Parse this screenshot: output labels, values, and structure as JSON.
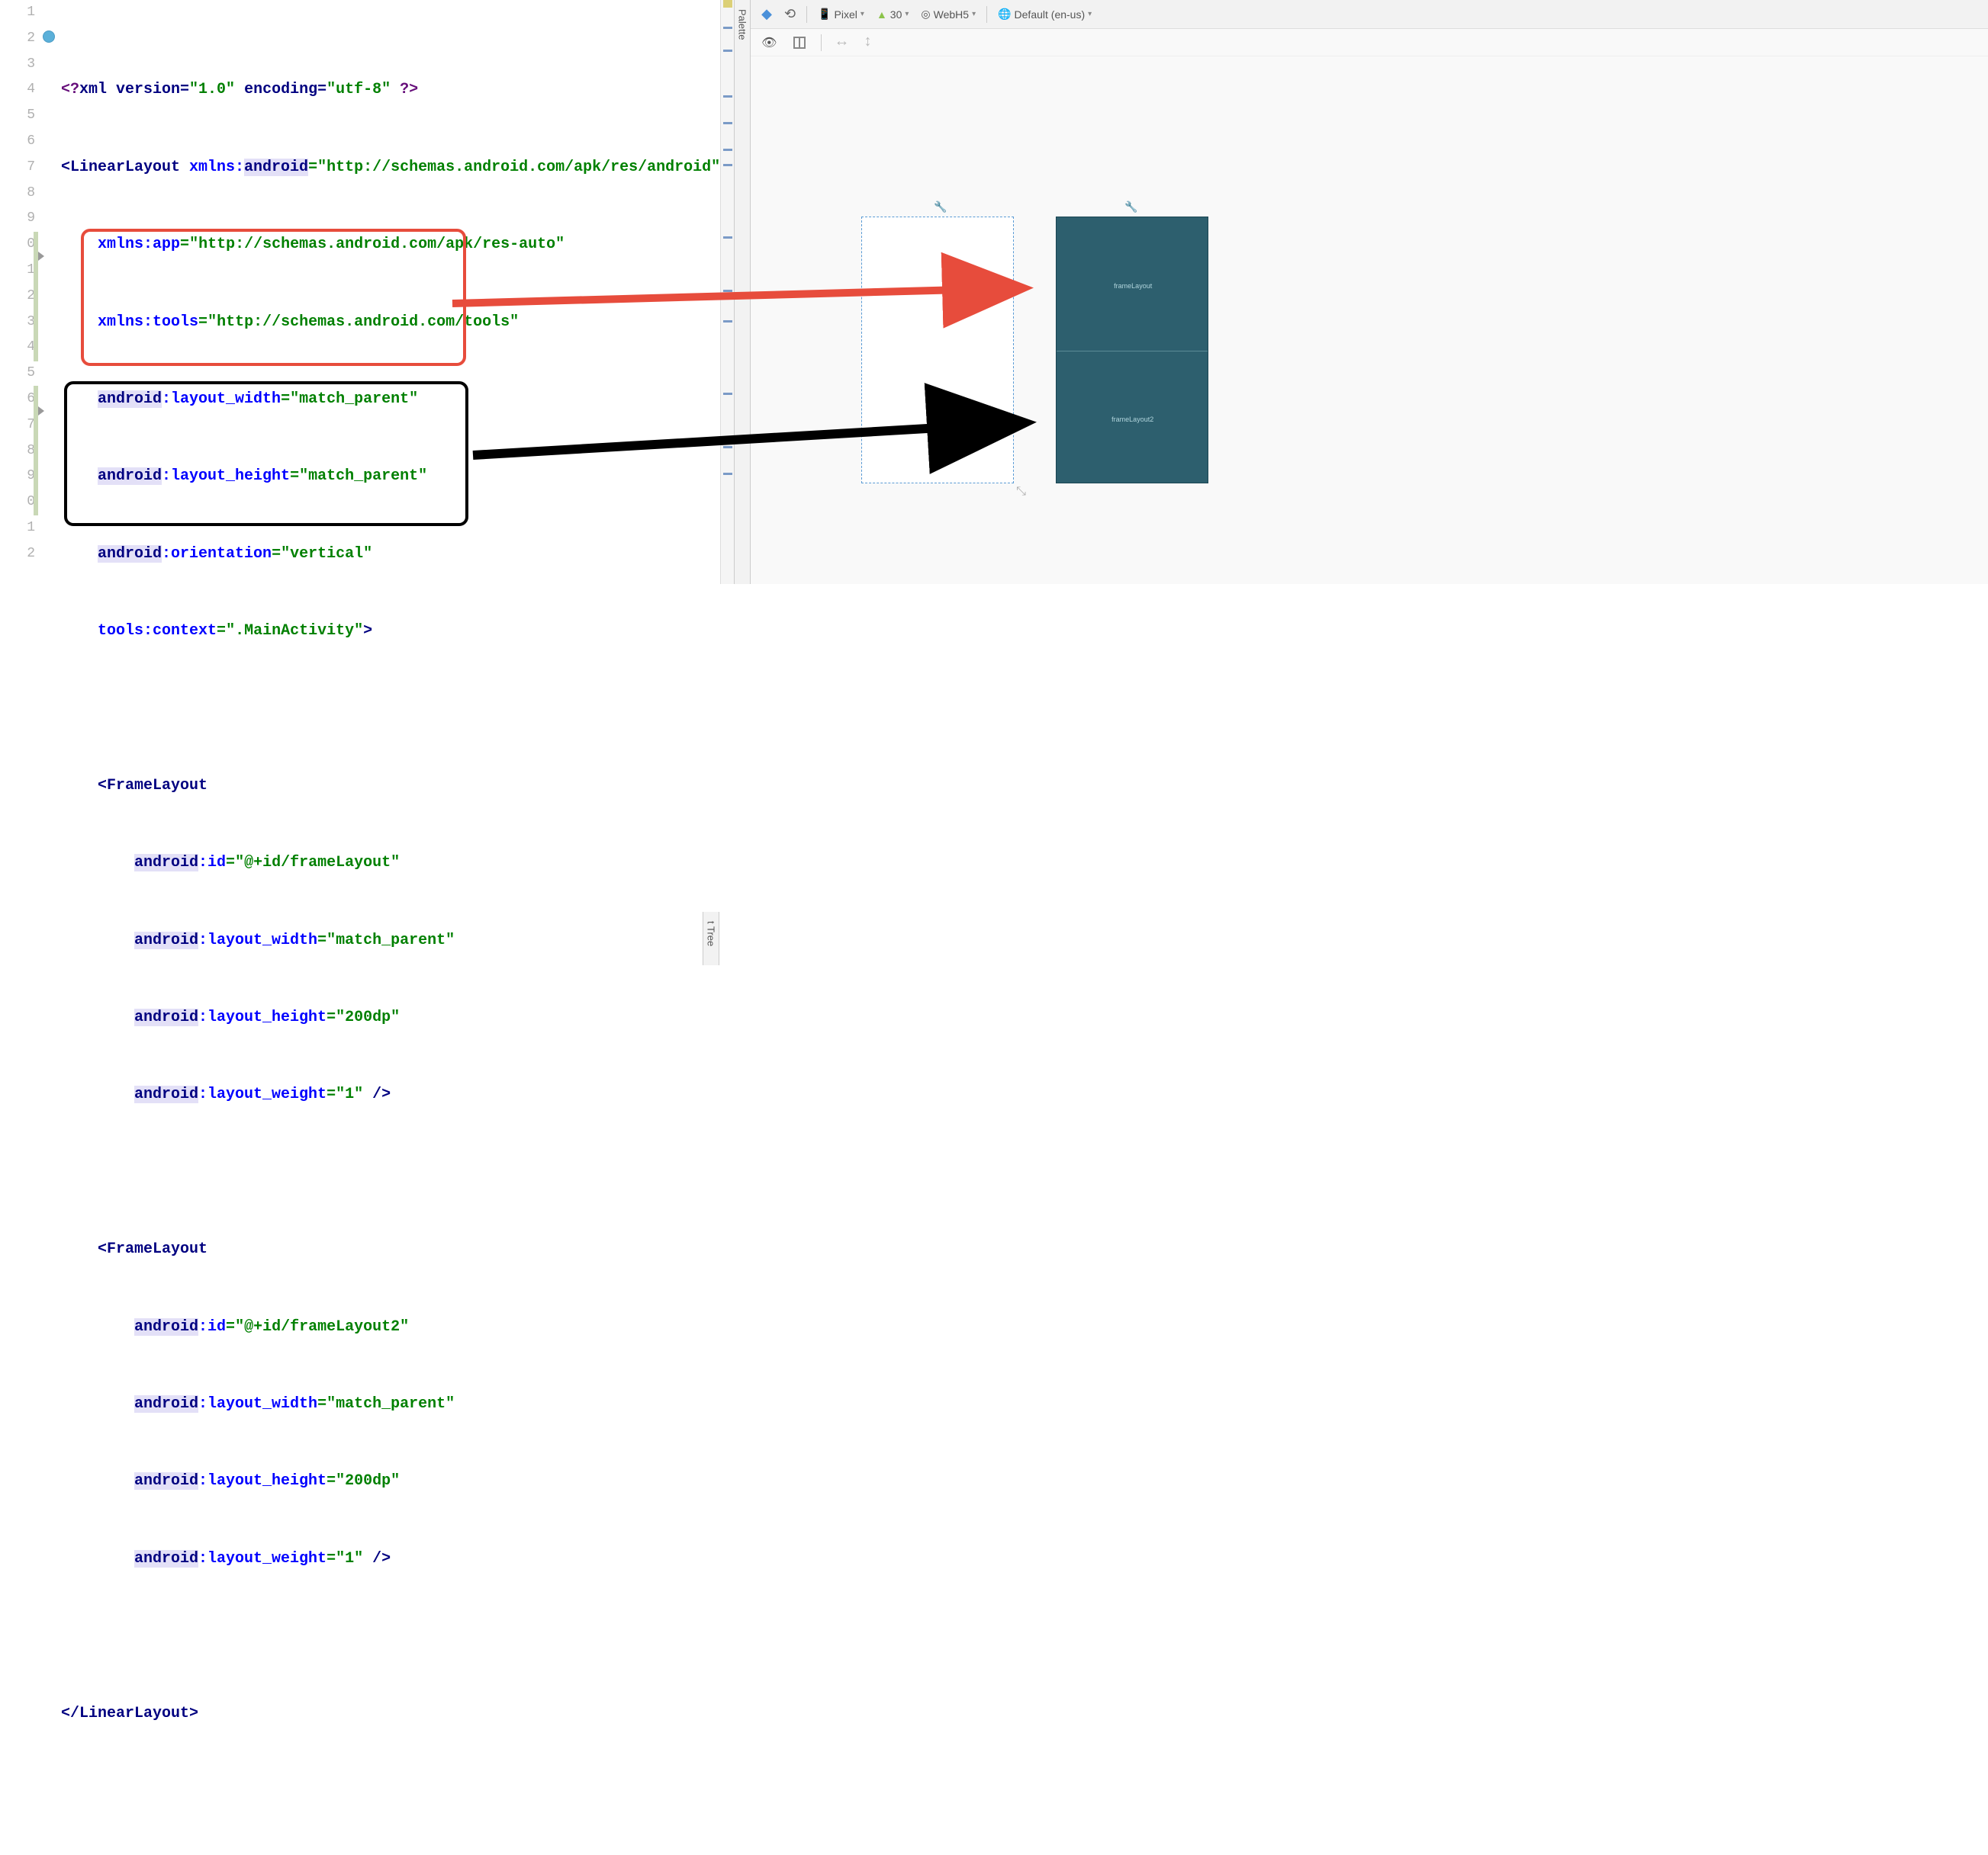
{
  "toolbar": {
    "device": "Pixel",
    "api": "30",
    "theme": "WebH5",
    "locale": "Default (en-us)"
  },
  "palette_label": "Palette",
  "tree_label": "t Tree",
  "gutter_lines": [
    "1",
    "2",
    "3",
    "4",
    "5",
    "6",
    "7",
    "8",
    "9",
    "0",
    "1",
    "2",
    "3",
    "4",
    "5",
    "6",
    "7",
    "8",
    "9",
    "0",
    "1",
    "2"
  ],
  "code": {
    "l1_open": "<?",
    "l1_xml": "xml version=",
    "l1_v": "\"1.0\"",
    "l1_enc": " encoding=",
    "l1_e": "\"utf-8\"",
    "l1_close": " ?>",
    "l2_tag": "<LinearLayout ",
    "l2_ns": "xmlns:",
    "l2_android": "android",
    "l2_eq": "=",
    "l2_url": "\"http://schemas.android.com/apk/res/android\"",
    "l3_ns": "xmlns:",
    "l3_app": "app",
    "l3_eq": "=",
    "l3_url": "\"http://schemas.android.com/apk/res-auto\"",
    "l4_ns": "xmlns:",
    "l4_tools": "tools",
    "l4_eq": "=",
    "l4_url": "\"http://schemas.android.com/tools\"",
    "l5_a": "android",
    "l5_attr": ":layout_width",
    "l5_eq": "=",
    "l5_v": "\"match_parent\"",
    "l6_a": "android",
    "l6_attr": ":layout_height",
    "l6_eq": "=",
    "l6_v": "\"match_parent\"",
    "l7_a": "android",
    "l7_attr": ":orientation",
    "l7_eq": "=",
    "l7_v": "\"vertical\"",
    "l8_ns": "tools:",
    "l8_attr": "context",
    "l8_eq": "=",
    "l8_v": "\".MainActivity\"",
    "l8_close": ">",
    "l10_tag": "<FrameLayout",
    "l11_a": "android",
    "l11_attr": ":id",
    "l11_eq": "=",
    "l11_v": "\"@+id/frameLayout\"",
    "l12_a": "android",
    "l12_attr": ":layout_width",
    "l12_eq": "=",
    "l12_v": "\"match_parent\"",
    "l13_a": "android",
    "l13_attr": ":layout_height",
    "l13_eq": "=",
    "l13_v": "\"200dp\"",
    "l14_a": "android",
    "l14_attr": ":layout_weight",
    "l14_eq": "=",
    "l14_v": "\"1\"",
    "l14_close": " />",
    "l16_tag": "<FrameLayout",
    "l17_a": "android",
    "l17_attr": ":id",
    "l17_eq": "=",
    "l17_v": "\"@+id/frameLayout2\"",
    "l18_a": "android",
    "l18_attr": ":layout_width",
    "l18_eq": "=",
    "l18_v": "\"match_parent\"",
    "l19_a": "android",
    "l19_attr": ":layout_height",
    "l19_eq": "=",
    "l19_v": "\"200dp\"",
    "l20_a": "android",
    "l20_attr": ":layout_weight",
    "l20_eq": "=",
    "l20_v": "\"1\"",
    "l20_close": " />",
    "l22_tag": "</LinearLayout>"
  },
  "preview": {
    "frame1_label": "frameLayout",
    "frame2_label": "frameLayout2"
  }
}
